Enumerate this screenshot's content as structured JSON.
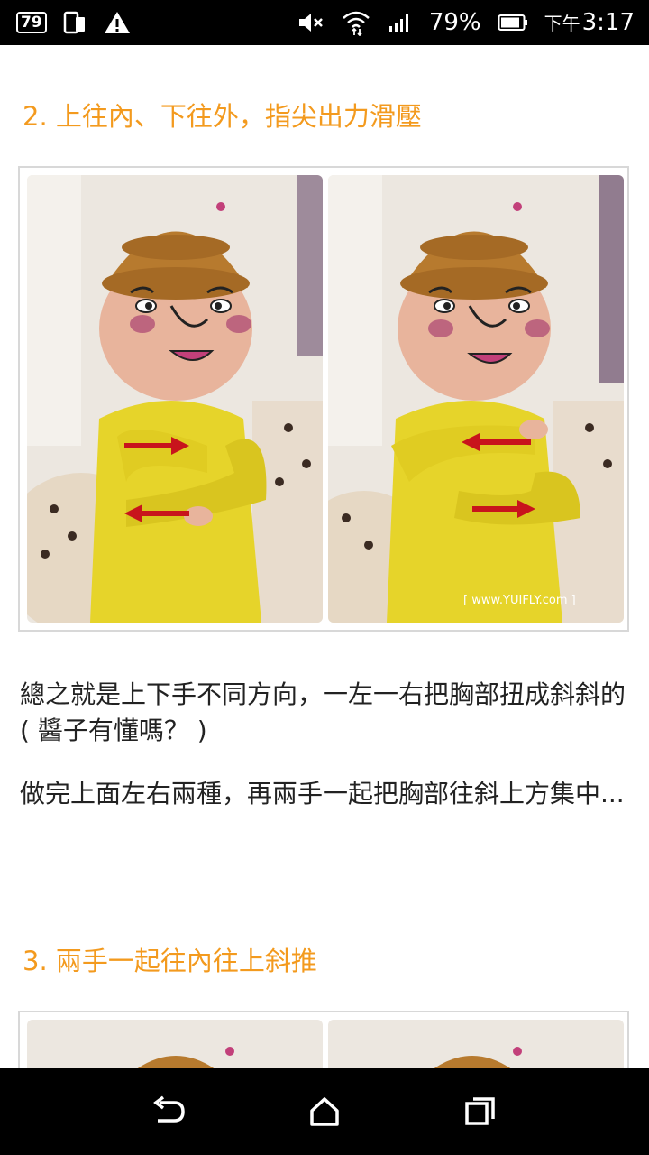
{
  "status_bar": {
    "notification_badge": "79",
    "battery_percent": "79%",
    "time_prefix": "下午",
    "time": "3:17",
    "icons": [
      "notification-badge",
      "phone-rotate-icon",
      "warning-icon",
      "mute-icon",
      "wifi-icon",
      "signal-icon",
      "battery-icon"
    ]
  },
  "article": {
    "step2_heading": "2. 上往內、下往外，指尖出力滑壓",
    "photo_watermark": "[ www.YUIFLY.com ]",
    "paragraph1": "總之就是上下手不同方向，一左一右把胸部扭成斜斜的 ( 醬子有懂嗎？ )",
    "paragraph2": "做完上面左右兩種，再兩手一起把胸部往斜上方集中...",
    "step3_heading": "3. 兩手一起往內往上斜推"
  },
  "nav_bar": {
    "buttons": [
      "back",
      "home",
      "recents"
    ]
  },
  "colors": {
    "heading_orange": "#f39a1e",
    "arrow_red": "#c8141c",
    "shirt_yellow": "#e6d42a",
    "hat_brown": "#b77a2e"
  }
}
